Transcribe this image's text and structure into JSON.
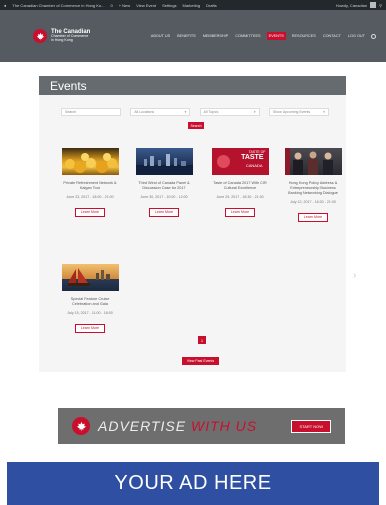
{
  "admin_bar": {
    "items": [
      "The Canadian Chamber of Commerce in Hong Ko...",
      "0",
      "+ New",
      "View Event",
      "Settings",
      "Marketing",
      "Drafts"
    ],
    "user": "Howdy, Canadian"
  },
  "header": {
    "logo_line1": "The Canadian",
    "logo_line2": "Chamber of Commerce",
    "logo_line3": "in Hong Kong",
    "nav": [
      "About Us",
      "Benefits",
      "Membership",
      "Committees",
      "Events",
      "Resources",
      "Contact",
      "Log Out"
    ]
  },
  "events": {
    "title": "Events",
    "filters": [
      {
        "label": "Search",
        "value": ""
      },
      {
        "label": "All Locations",
        "value": "All Locations"
      },
      {
        "label": "All Topics",
        "value": "All Topics"
      },
      {
        "label": "Show Upcoming Events",
        "value": "Show Upcoming Events"
      }
    ],
    "search_label": "Search",
    "cards": [
      {
        "title": "Private Refreshment Network & Kalgan Tour",
        "date": "June 23, 2017 - 18:00 - 21:00",
        "button": "Learn More"
      },
      {
        "title": "Third Wind of Canada Panel & Discussion Case for 2017",
        "date": "June 30, 2017 - 10:00 - 12:00",
        "button": "Learn More"
      },
      {
        "title": "Taste of Canada 2017 With CIR Cultural Excellence",
        "date": "June 29, 2017 - 18:30 - 21:30",
        "button": "Learn More"
      },
      {
        "title": "Hong Kong Policy Address & Entrepreneurship Business Banking Networking Dialogue",
        "date": "July 12, 2017 - 18:30 - 21:00",
        "button": "Learn More"
      },
      {
        "title": "Special Feature Cruise Celebration and Gala",
        "date": "July 15, 2017 - 11:00 - 18:00",
        "button": "Learn More"
      }
    ],
    "taste_label_1": "TASTE OF",
    "taste_label_2": "TASTE",
    "taste_label_3": "CANADA",
    "page_number": "1",
    "past_events_label": "View Past Events"
  },
  "advertise": {
    "text_part1": "ADVERTISE ",
    "text_part2": "WITH US",
    "button": "START NOW"
  },
  "bottom_banner": "YOUR AD HERE",
  "colors": {
    "accent": "#c8102e",
    "header_bg": "#555b60",
    "ad_blue": "#2e4fa2"
  }
}
